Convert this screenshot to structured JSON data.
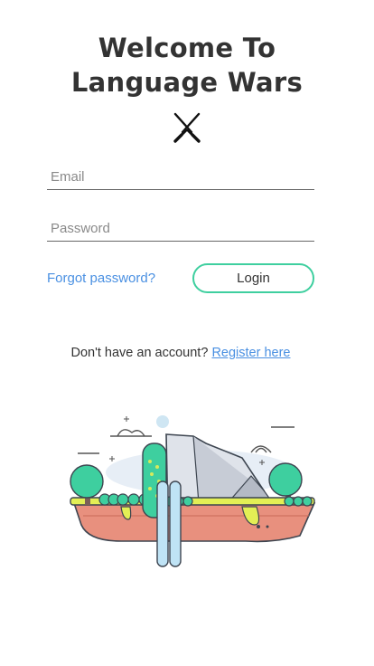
{
  "title": {
    "line1": "Welcome To",
    "line2": "Language Wars"
  },
  "logo_icon": "crossed-swords-icon",
  "form": {
    "email_placeholder": "Email",
    "email_value": "",
    "password_placeholder": "Password",
    "password_value": ""
  },
  "actions": {
    "forgot_label": "Forgot password?",
    "login_label": "Login"
  },
  "register": {
    "prompt": "Don't have an account?",
    "link_label": "Register here"
  },
  "illustration": "floating-island-landscape-illustration",
  "colors": {
    "title": "#333333",
    "link": "#4a90e2",
    "accent": "#3ecf9f"
  }
}
